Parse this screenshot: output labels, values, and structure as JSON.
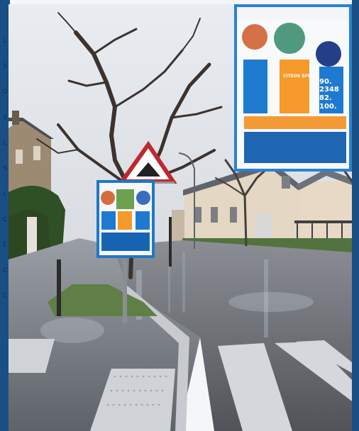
{
  "panel": {
    "stats": [
      "90.",
      "2348",
      "82.",
      "100."
    ],
    "brand": "CITÉOS SPIE"
  },
  "left_text": [
    "L",
    "S",
    "O",
    "S",
    "C",
    "S",
    "L",
    "C",
    "E",
    "C",
    "C"
  ],
  "scene": {
    "sign": "warning",
    "road": "wet street",
    "trees": "bare"
  }
}
